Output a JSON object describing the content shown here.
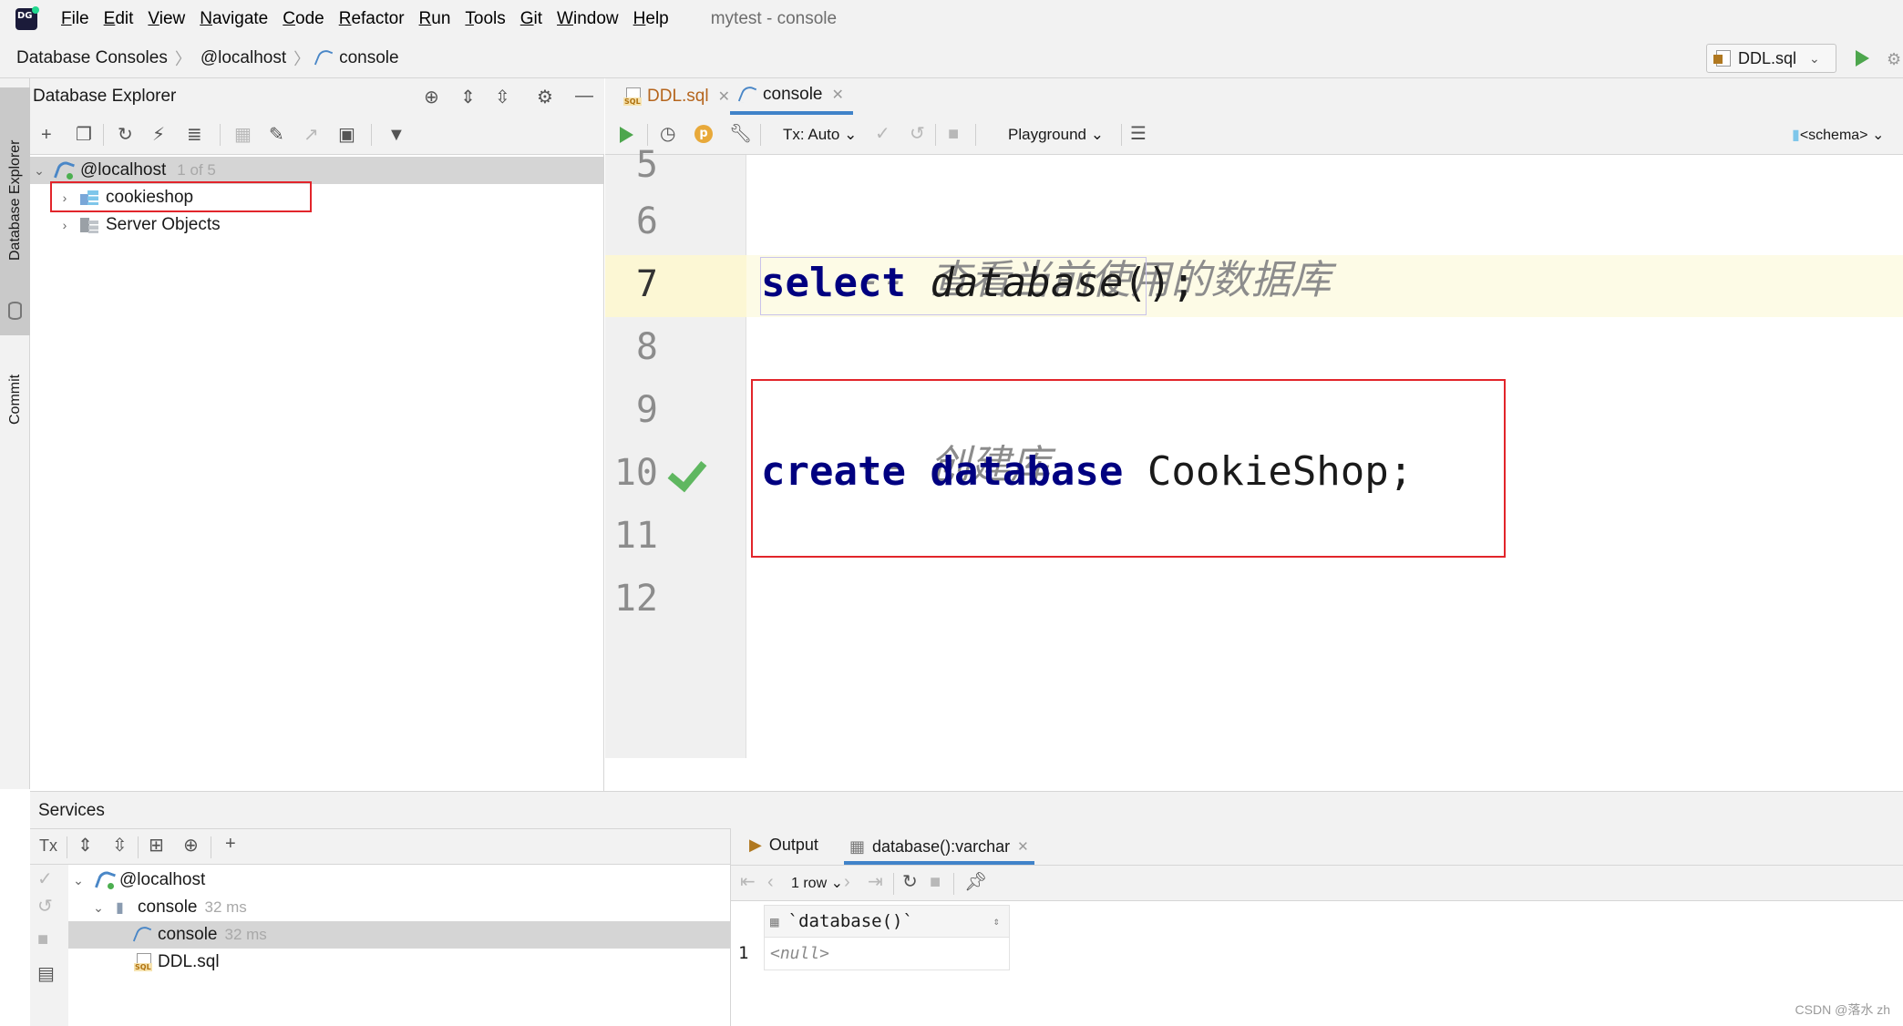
{
  "menu": {
    "items": [
      "File",
      "Edit",
      "View",
      "Navigate",
      "Code",
      "Refactor",
      "Run",
      "Tools",
      "Git",
      "Window",
      "Help"
    ],
    "window_title": "mytest - console"
  },
  "breadcrumb": {
    "items": [
      "Database Consoles",
      "@localhost",
      "console"
    ]
  },
  "run_config": {
    "label": "DDL.sql"
  },
  "left_strip": {
    "database_explorer": "Database Explorer",
    "commit": "Commit"
  },
  "explorer": {
    "title": "Database Explorer",
    "root": {
      "label": "@localhost",
      "count": "1 of 5"
    },
    "children": [
      {
        "label": "cookieshop"
      },
      {
        "label": "Server Objects"
      }
    ]
  },
  "editor": {
    "tabs": [
      {
        "label": "DDL.sql"
      },
      {
        "label": "console"
      }
    ],
    "toolbar": {
      "tx": "Tx: Auto",
      "playground": "Playground",
      "schema": "<schema>"
    },
    "line_numbers": [
      "5",
      "6",
      "7",
      "8",
      "9",
      "10",
      "11",
      "12"
    ],
    "lines": {
      "l6_comment": "-- 查看当前使用的数据库",
      "l7_kw": "select",
      "l7_fn": "database",
      "l7_rest": "();",
      "l9_comment": "-- 创建库",
      "l10_kw1": "create",
      "l10_kw2": "database",
      "l10_rest": "CookieShop;"
    }
  },
  "services": {
    "title": "Services",
    "tx_label": "Tx",
    "tree": [
      {
        "label": "@localhost",
        "time": ""
      },
      {
        "label": "console",
        "time": "32 ms"
      },
      {
        "label": "console",
        "time": "32 ms"
      },
      {
        "label": "DDL.sql",
        "time": ""
      }
    ],
    "result_tabs": [
      {
        "label": "Output"
      },
      {
        "label": "database():varchar"
      }
    ],
    "rows_label": "1 row",
    "grid": {
      "column": "`database()`",
      "row_number": "1",
      "value": "<null>"
    }
  },
  "watermark": "CSDN @落水 zh",
  "colors": {
    "accent": "#4083c9",
    "highlight_box": "#e2252b",
    "keyword": "#000080",
    "success": "#5fb760"
  }
}
